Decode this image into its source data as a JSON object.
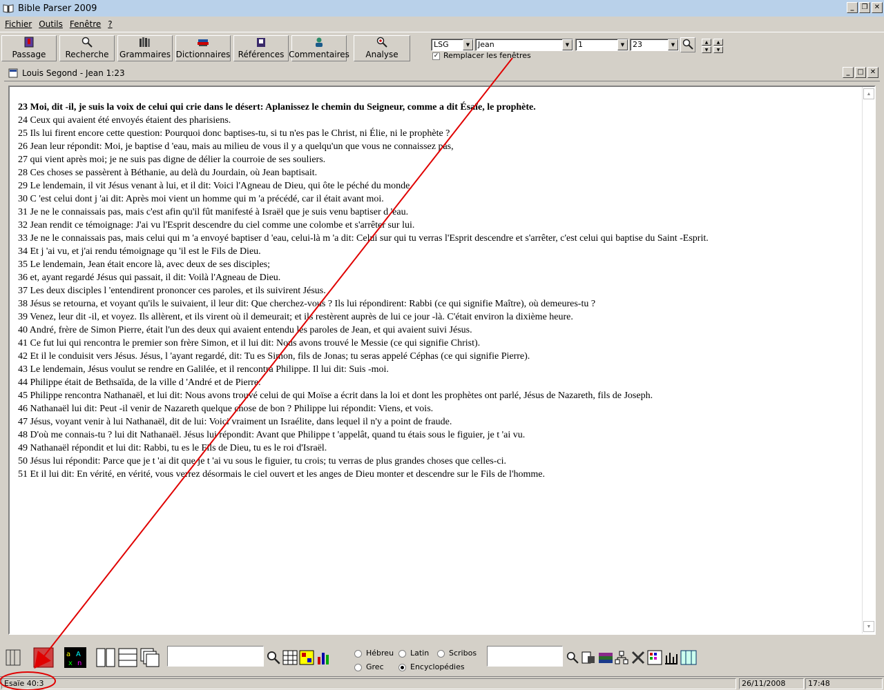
{
  "window": {
    "title": "Bible Parser 2009"
  },
  "menu": {
    "items": [
      "Fichier",
      "Outils",
      "Fenêtre",
      "?"
    ]
  },
  "toolbar": {
    "buttons": [
      "Passage",
      "Recherche",
      "Grammaires",
      "Dictionnaires",
      "Références",
      "Commentaires",
      "Analyse"
    ]
  },
  "navigator": {
    "version": "LSG",
    "book": "Jean",
    "chapter": "1",
    "verse": "23",
    "replace_windows_label": "Remplacer les fenêtres",
    "replace_windows_checked": true
  },
  "child": {
    "title": "Louis Segond - Jean 1:23"
  },
  "verses": [
    "23 Moi, dit -il, je suis la voix de celui qui crie dans le désert: Aplanissez le chemin du Seigneur, comme a dit Ésaïe, le prophète.",
    "24 Ceux qui avaient été envoyés étaient des pharisiens.",
    "25 Ils lui firent encore cette question: Pourquoi donc baptises-tu, si tu n'es pas le Christ, ni Élie, ni le prophète ?",
    "26 Jean leur répondit: Moi, je baptise d 'eau, mais au milieu de vous il y a quelqu'un que vous ne connaissez pas,",
    "27 qui vient après moi; je ne suis pas digne de délier la courroie de ses souliers.",
    "28 Ces choses se passèrent à Béthanie, au delà du Jourdain, où Jean baptisait.",
    "29 Le lendemain, il vit Jésus venant à lui, et il dit: Voici l'Agneau de Dieu, qui ôte le péché du monde.",
    "30 C 'est celui dont j 'ai dit: Après moi vient un homme qui m 'a précédé, car il était avant moi.",
    "31 Je ne le connaissais pas, mais c'est afin qu'il fût manifesté à Israël que je suis venu baptiser d 'eau.",
    "32 Jean rendit ce témoignage: J'ai vu l'Esprit descendre du ciel comme une colombe et s'arrêter sur lui.",
    "33 Je ne le connaissais pas, mais celui qui m 'a envoyé baptiser d 'eau, celui-là m 'a dit: Celui sur qui tu verras l'Esprit descendre et s'arrêter, c'est celui qui baptise du Saint -Esprit.",
    "34 Et j 'ai vu, et j'ai rendu témoignage qu 'il est le Fils de Dieu.",
    "35 Le lendemain, Jean était encore là, avec deux de ses disciples;",
    "36 et, ayant regardé Jésus qui passait, il dit: Voilà l'Agneau de Dieu.",
    "37 Les deux disciples l 'entendirent prononcer ces paroles, et ils suivirent Jésus.",
    "38 Jésus se retourna, et voyant qu'ils le suivaient, il leur dit: Que cherchez-vous ? Ils lui répondirent: Rabbi (ce qui signifie Maître), où demeures-tu ?",
    "39 Venez, leur dit -il, et voyez. Ils allèrent, et ils virent où il demeurait; et ils restèrent auprès de lui ce jour -là. C'était environ la dixième heure.",
    "40 André, frère de Simon Pierre, était l'un des deux qui avaient entendu les paroles de Jean, et qui avaient suivi Jésus.",
    "41 Ce fut lui qui rencontra le premier son frère Simon, et il lui dit: Nous avons trouvé le Messie (ce qui signifie Christ).",
    "42 Et il le conduisit vers Jésus. Jésus, l 'ayant regardé, dit: Tu es Simon, fils de Jonas; tu seras appelé Céphas (ce qui signifie Pierre).",
    "43 Le lendemain, Jésus voulut se rendre en Galilée, et il rencontra Philippe. Il lui dit: Suis -moi.",
    "44 Philippe était de Bethsaïda, de la ville d 'André et de Pierre.",
    "45 Philippe rencontra Nathanaël, et lui dit: Nous avons trouvé celui de qui Moïse a écrit dans la loi et dont les prophètes ont parlé, Jésus de Nazareth, fils de Joseph.",
    "46 Nathanaël lui dit: Peut -il venir de Nazareth quelque chose de bon ? Philippe lui répondit: Viens, et vois.",
    "47 Jésus, voyant venir à lui Nathanaël, dit de lui: Voici vraiment un Israélite, dans lequel il n'y a point de fraude.",
    "48 D'où me connais-tu ? lui dit Nathanaël. Jésus lui répondit: Avant que Philippe t 'appelât, quand tu étais sous le figuier, je t 'ai vu.",
    "49 Nathanaël répondit et lui dit: Rabbi, tu es le Fils de Dieu, tu es le roi d'Israël.",
    "50 Jésus lui répondit: Parce que je t 'ai dit que je t 'ai vu sous le figuier, tu crois; tu verras de plus grandes choses que celles-ci.",
    "51 Et il lui dit: En vérité, en vérité, vous verrez désormais le ciel ouvert et les anges de Dieu monter et descendre sur le Fils de l'homme."
  ],
  "bottom": {
    "radios": [
      {
        "label": "Hébreu",
        "checked": false
      },
      {
        "label": "Latin",
        "checked": false
      },
      {
        "label": "Scribos",
        "checked": false
      },
      {
        "label": "Grec",
        "checked": false
      },
      {
        "label": "Encyclopédies",
        "checked": true
      }
    ]
  },
  "status": {
    "reference": "Esaïe 40:3",
    "date": "26/11/2008",
    "time": "17:48"
  },
  "colors": {
    "annotation": "#e00000",
    "titlebar": "#b9d1ea",
    "face": "#d4d0c8"
  }
}
